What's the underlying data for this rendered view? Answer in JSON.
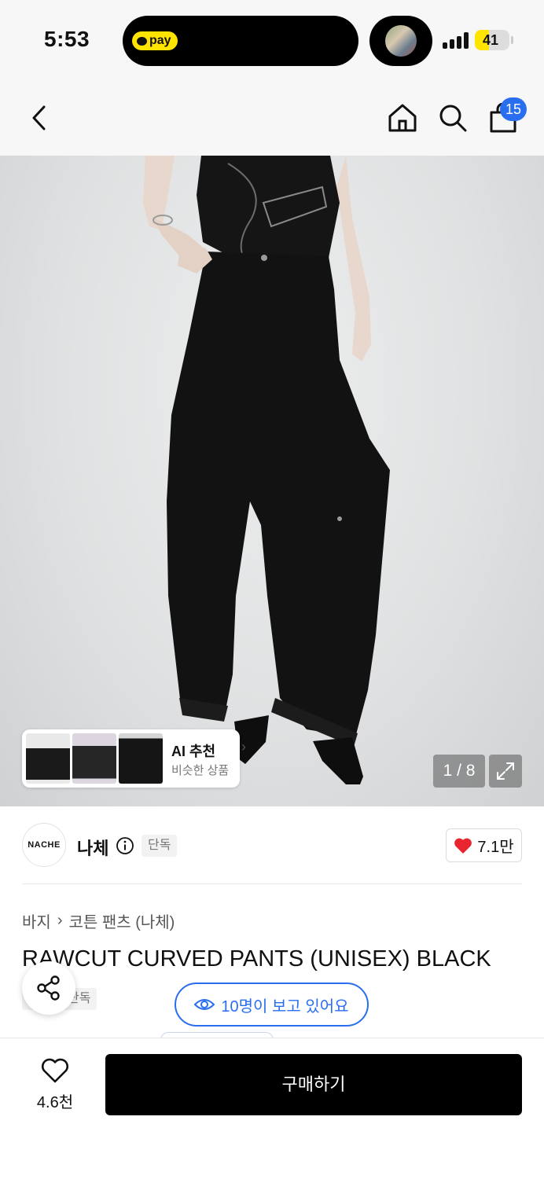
{
  "status_bar": {
    "time": "5:53",
    "pay_label": "pay",
    "battery_percent": "41",
    "battery_level": 0.41
  },
  "header": {
    "cart_count": "15"
  },
  "gallery": {
    "counter": "1 / 8",
    "ai_title": "AI 추천",
    "ai_subtitle": "비슷한 상품"
  },
  "brand": {
    "logo_text": "NACHE",
    "name": "나체",
    "exclusive_tag": "단독",
    "likes": "7.1만"
  },
  "product": {
    "breadcrumb": [
      "바지",
      "코튼 팬츠 (나체)"
    ],
    "title": "RAWCUT CURVED PANTS (UNISEX) BLACK",
    "tag": "단독",
    "viewers": "10명이 보고 있어요"
  },
  "bottom": {
    "wish_count": "4.6천",
    "buy_label": "구매하기"
  },
  "colors": {
    "accent_blue": "#2a6ef0",
    "kakao_yellow": "#ffe400",
    "heart_red": "#e8242f"
  }
}
